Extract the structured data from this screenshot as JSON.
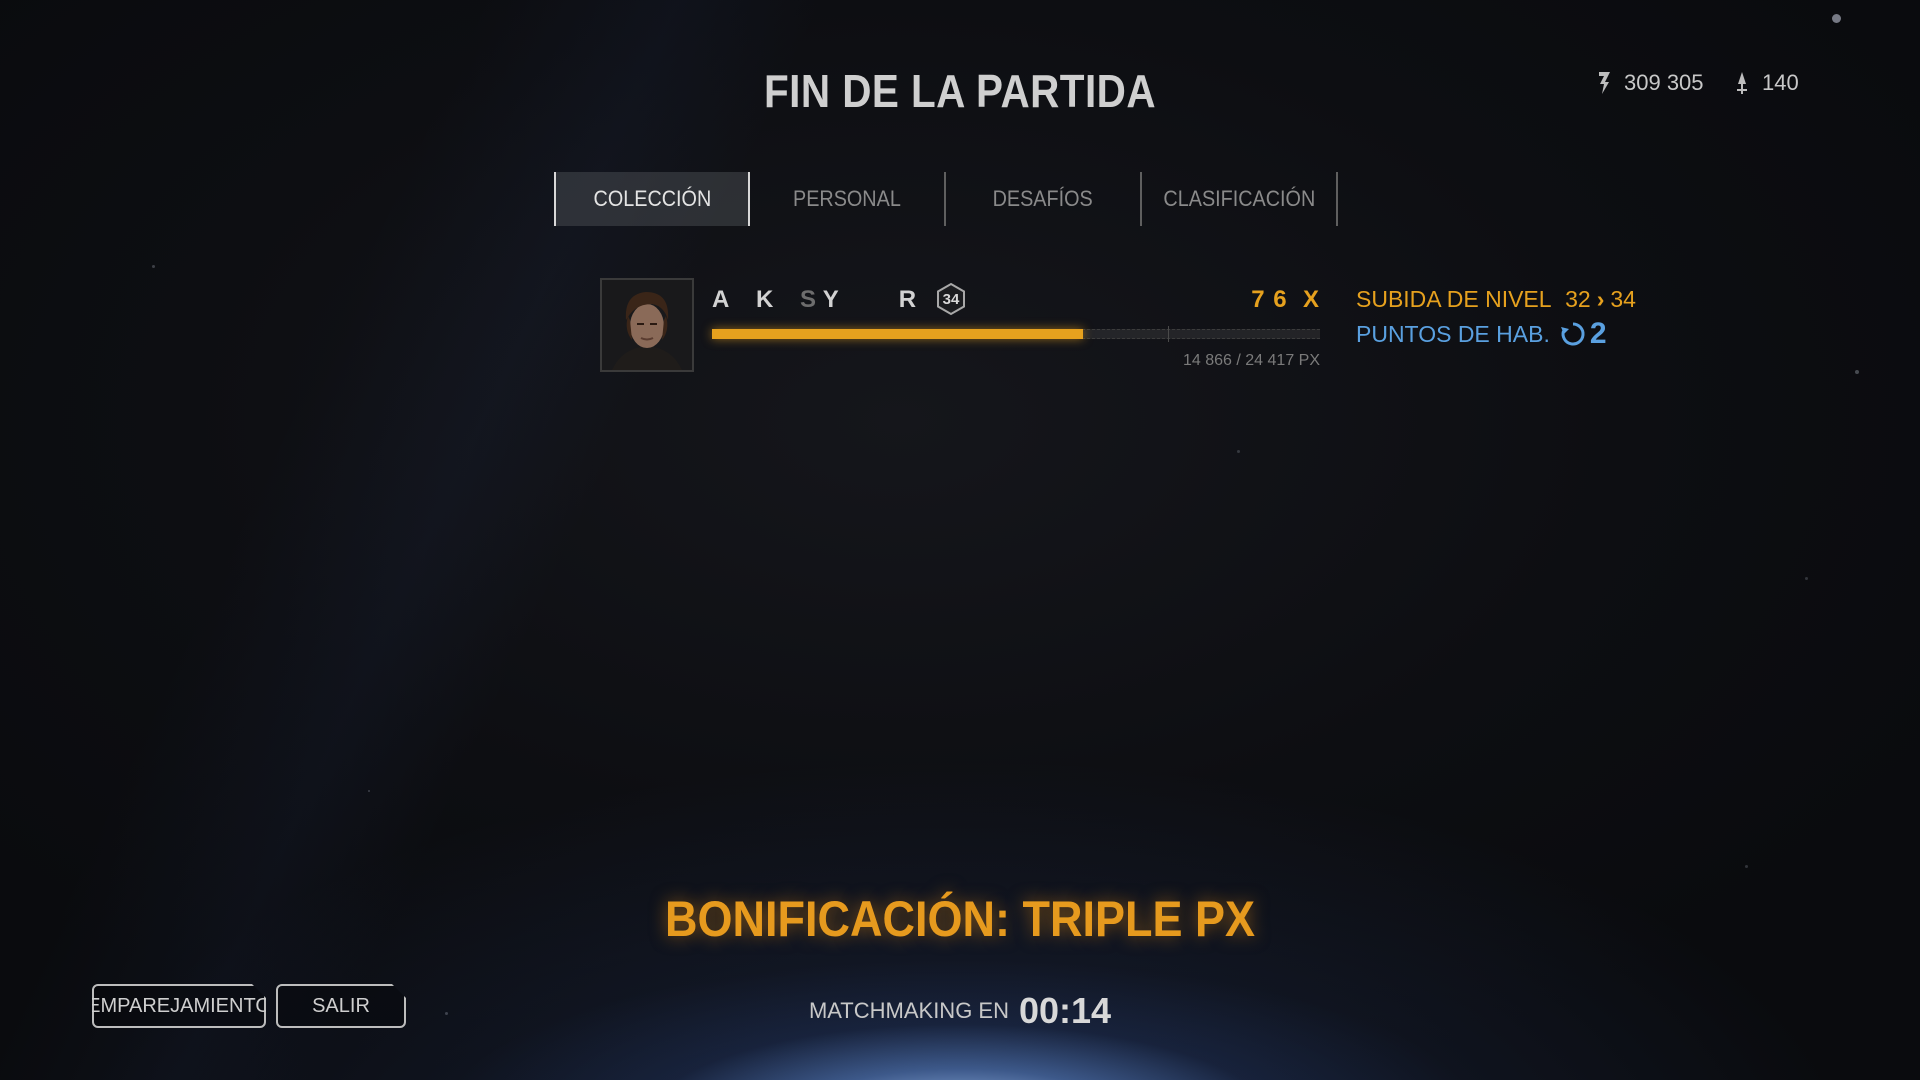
{
  "title": "FIN DE LA PARTIDA",
  "currency": {
    "credits_icon": "credits-icon",
    "credits": "309 305",
    "crystals_icon": "crystals-icon",
    "crystals": "140"
  },
  "tabs": [
    {
      "label": "COLECCIÓN",
      "active": true
    },
    {
      "label": "PERSONAL",
      "active": false
    },
    {
      "label": "DESAFÍOS",
      "active": false
    },
    {
      "label": "CLASIFICACIÓN",
      "active": false
    }
  ],
  "player": {
    "name_parts": [
      "A",
      "K",
      "S",
      "Y",
      "R"
    ],
    "level": "34",
    "xp_gained": "7 6  X",
    "xp_progress_text": "14 866 / 24 417 PX",
    "xp_fraction": 0.61
  },
  "level_up": {
    "label": "SUBIDA DE NIVEL",
    "from": "32",
    "to": "34"
  },
  "skill_points": {
    "label": "PUNTOS DE HAB.",
    "icon": "skill-point-icon",
    "count": "2"
  },
  "bonus": "BONIFICACIÓN: TRIPLE PX",
  "matchmaking": {
    "label": "MATCHMAKING EN",
    "timer": "00:14"
  },
  "buttons": {
    "matchmaking": "EMPAREJAMIENTO",
    "exit": "SALIR"
  },
  "colors": {
    "accent_orange": "#e6a11e",
    "skill_blue": "#5aa0e0"
  }
}
